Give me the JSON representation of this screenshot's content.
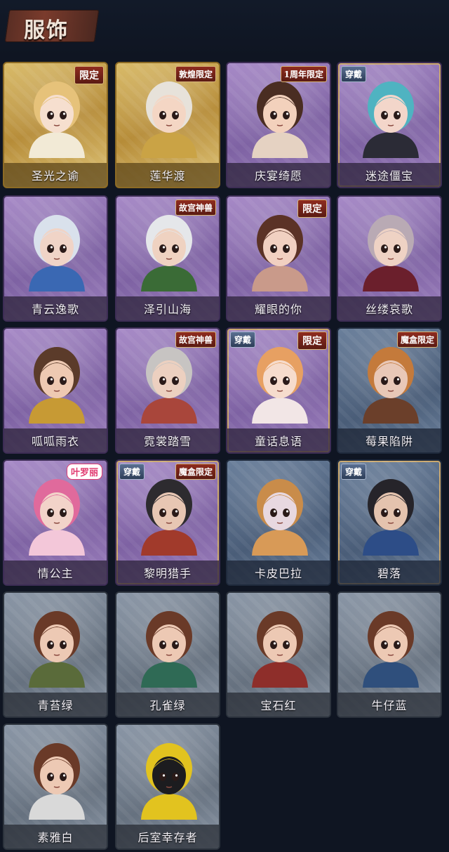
{
  "header": {
    "title": "服饰"
  },
  "cards": [
    {
      "label": "圣光之谕",
      "badge": "限定",
      "badge_type": "right",
      "equipped": false,
      "theme": "gold",
      "hair": "#e6c27a",
      "skin": "#f6dfcf",
      "outfit": "#f2ead6"
    },
    {
      "label": "莲华渡",
      "badge": "敦煌限定",
      "badge_type": "right-long",
      "equipped": false,
      "theme": "gold",
      "hair": "#e7e2da",
      "skin": "#f4d6c4",
      "outfit": "#caa345"
    },
    {
      "label": "庆宴绮愿",
      "badge": "1周年限定",
      "badge_type": "right-long",
      "equipped": false,
      "theme": "purple",
      "hair": "#4a2d22",
      "skin": "#f3d1bc",
      "outfit": "#e5d2c2"
    },
    {
      "label": "迷途僵宝",
      "badge": "穿戴",
      "badge_type": "left",
      "equipped": true,
      "theme": "purple",
      "hair": "#4fb3c1",
      "skin": "#f3d6ca",
      "outfit": "#2b2b36"
    },
    {
      "label": "青云逸歌",
      "badge": "",
      "badge_type": "",
      "equipped": false,
      "theme": "purple",
      "hair": "#d9e1ec",
      "skin": "#f0d4c7",
      "outfit": "#3a68b3"
    },
    {
      "label": "泽引山海",
      "badge": "故宫神兽",
      "badge_type": "right-long",
      "equipped": false,
      "theme": "purple",
      "hair": "#e5e7ea",
      "skin": "#efd2c1",
      "outfit": "#3a6b36"
    },
    {
      "label": "耀眼的你",
      "badge": "限定",
      "badge_type": "right",
      "equipped": false,
      "theme": "purple",
      "hair": "#5b3226",
      "skin": "#f1d0c1",
      "outfit": "#c99a8a"
    },
    {
      "label": "丝缕哀歌",
      "badge": "",
      "badge_type": "",
      "equipped": false,
      "theme": "purple",
      "hair": "#b9aab4",
      "skin": "#eed2c4",
      "outfit": "#6b1f2c"
    },
    {
      "label": "呱呱雨衣",
      "badge": "",
      "badge_type": "",
      "equipped": false,
      "theme": "purple",
      "hair": "#5b3b2a",
      "skin": "#eec9b2",
      "outfit": "#c79a34"
    },
    {
      "label": "霓裳踏雪",
      "badge": "故宫神兽",
      "badge_type": "right-long",
      "equipped": false,
      "theme": "purple",
      "hair": "#c7c4c2",
      "skin": "#ecd0c0",
      "outfit": "#a9463b"
    },
    {
      "label": "童话息语",
      "badge": "限定",
      "badge_type": "right",
      "second_badge": "穿戴",
      "equipped": true,
      "theme": "purple",
      "hair": "#e7a062",
      "skin": "#f6dccd",
      "outfit": "#f2e6e6"
    },
    {
      "label": "莓果陷阱",
      "badge": "魔盒限定",
      "badge_type": "right-long",
      "equipped": false,
      "theme": "blue",
      "hair": "#c47a3b",
      "skin": "#e9c8b7",
      "outfit": "#6b3f2a"
    },
    {
      "label": "情公主",
      "badge": "叶罗丽",
      "badge_type": "pink",
      "equipped": false,
      "theme": "purple",
      "hair": "#e06a9c",
      "skin": "#f2d3c9",
      "outfit": "#f3c7d9"
    },
    {
      "label": "黎明猎手",
      "badge": "魔盒限定",
      "badge_type": "right-long",
      "second_badge": "穿戴",
      "equipped": true,
      "theme": "purple",
      "hair": "#2d2b2f",
      "skin": "#e7c6b3",
      "outfit": "#a13a2b"
    },
    {
      "label": "卡皮巴拉",
      "badge": "",
      "badge_type": "",
      "equipped": false,
      "theme": "blue",
      "hair": "#c98c4a",
      "skin": "#e8d8e0",
      "outfit": "#d89a57"
    },
    {
      "label": "碧落",
      "badge": "穿戴",
      "badge_type": "left",
      "equipped": true,
      "theme": "blue",
      "hair": "#26242a",
      "skin": "#e4c3ae",
      "outfit": "#2d4d87"
    },
    {
      "label": "青苔绿",
      "badge": "",
      "badge_type": "",
      "equipped": false,
      "theme": "gray",
      "hair": "#6a3a28",
      "skin": "#edc9b4",
      "outfit": "#5a6b3a"
    },
    {
      "label": "孔雀绿",
      "badge": "",
      "badge_type": "",
      "equipped": false,
      "theme": "gray",
      "hair": "#6a3a28",
      "skin": "#edc9b4",
      "outfit": "#2f6a55"
    },
    {
      "label": "宝石红",
      "badge": "",
      "badge_type": "",
      "equipped": false,
      "theme": "gray",
      "hair": "#6a3a28",
      "skin": "#edc9b4",
      "outfit": "#8e2e2a"
    },
    {
      "label": "牛仔蓝",
      "badge": "",
      "badge_type": "",
      "equipped": false,
      "theme": "gray",
      "hair": "#6a3a28",
      "skin": "#edc9b4",
      "outfit": "#2f4f7c"
    },
    {
      "label": "素雅白",
      "badge": "",
      "badge_type": "",
      "equipped": false,
      "theme": "gray",
      "hair": "#6a3a28",
      "skin": "#edc9b4",
      "outfit": "#d9d9d9"
    },
    {
      "label": "后室幸存者",
      "badge": "",
      "badge_type": "",
      "equipped": false,
      "theme": "gray",
      "hair": "#e2c31f",
      "skin": "#1c1c1f",
      "outfit": "#e2c31f"
    }
  ]
}
